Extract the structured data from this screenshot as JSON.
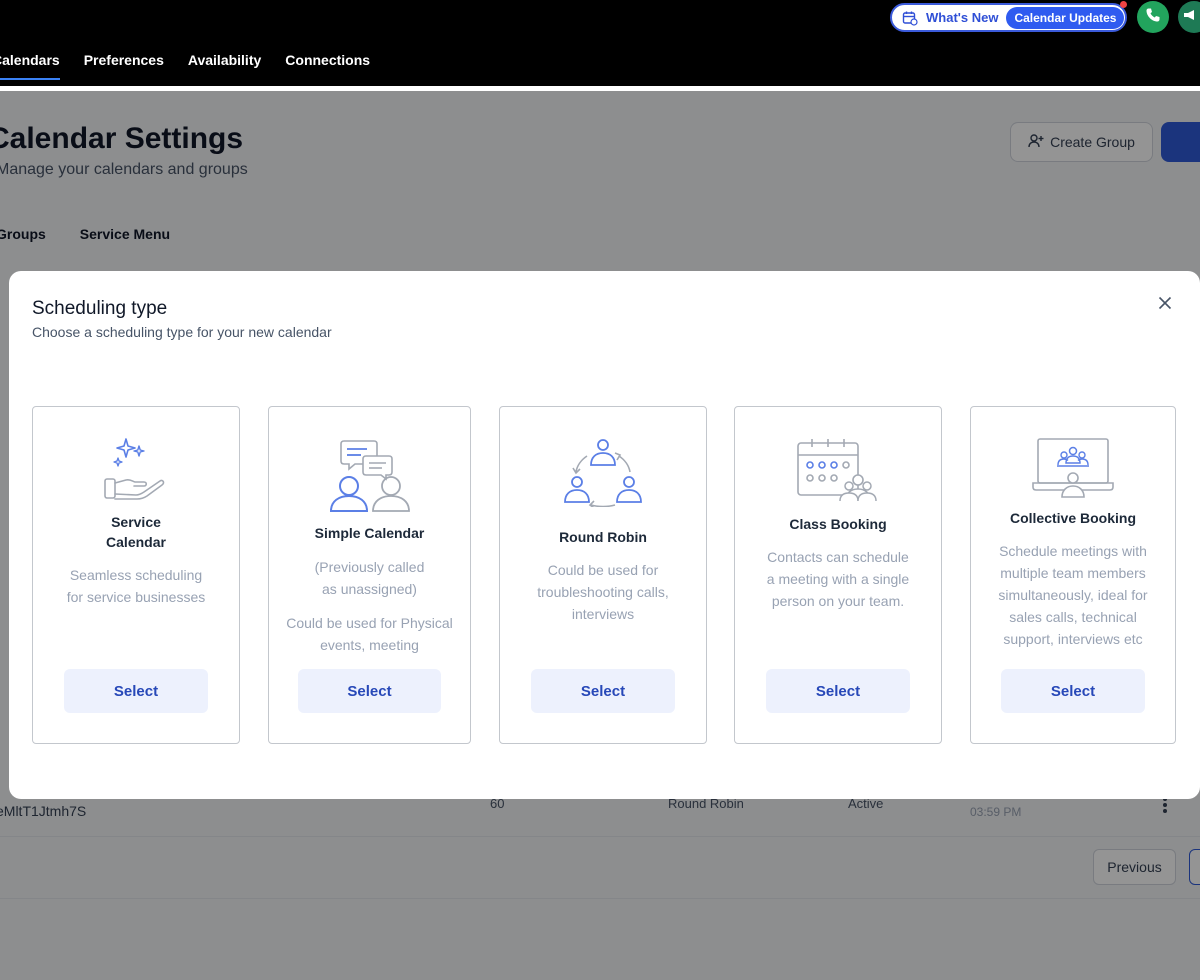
{
  "topbar": {
    "nav": [
      "Calendars",
      "Preferences",
      "Availability",
      "Connections"
    ],
    "whats_new_label": "What's New",
    "whats_new_pill": "Calendar Updates"
  },
  "background": {
    "title": "Calendar Settings",
    "subtitle": "Manage your calendars and groups",
    "create_group_label": "Create Group",
    "tabs": [
      "Groups",
      "Service Menu"
    ],
    "row_id": "eMltT1Jtmh7S",
    "row_duration": "60",
    "row_type": "Round Robin",
    "row_status": "Active",
    "row_time": "03:59 PM",
    "previous_label": "Previous"
  },
  "modal": {
    "title": "Scheduling type",
    "subtitle": "Choose a scheduling type for your new calendar",
    "cards": [
      {
        "title_line1": "Service",
        "title_line2": "Calendar",
        "desc_line1": "Seamless scheduling",
        "desc_line2": "for service businesses",
        "icon": "hand-sparkles-icon",
        "select_label": "Select"
      },
      {
        "title": "Simple Calendar",
        "note_line1": "(Previously called",
        "note_line2": "as unassigned)",
        "desc_line1": "Could be used for Physical",
        "desc_line2": "events, meeting",
        "icon": "people-chat-icon",
        "select_label": "Select"
      },
      {
        "title": "Round Robin",
        "desc_line1": "Could be used for",
        "desc_line2": "troubleshooting calls,",
        "desc_line3": "interviews",
        "icon": "round-robin-people-icon",
        "select_label": "Select"
      },
      {
        "title": "Class Booking",
        "desc_line1": "Contacts can schedule",
        "desc_line2": "a meeting with a single",
        "desc_line3": "person on your team.",
        "icon": "calendar-group-icon",
        "select_label": "Select"
      },
      {
        "title": "Collective Booking",
        "desc_line1": "Schedule meetings with",
        "desc_line2": "multiple team members",
        "desc_line3": "simultaneously, ideal for",
        "desc_line4": "sales calls, technical",
        "desc_line5": "support, interviews etc",
        "icon": "laptop-meeting-icon",
        "select_label": "Select"
      }
    ]
  },
  "colors": {
    "accent": "#2f5bd8",
    "select_bg": "#edf1fd",
    "select_text": "#2748b8",
    "illus_blue": "#5b7fe6",
    "illus_gray": "#a3a9b3"
  }
}
